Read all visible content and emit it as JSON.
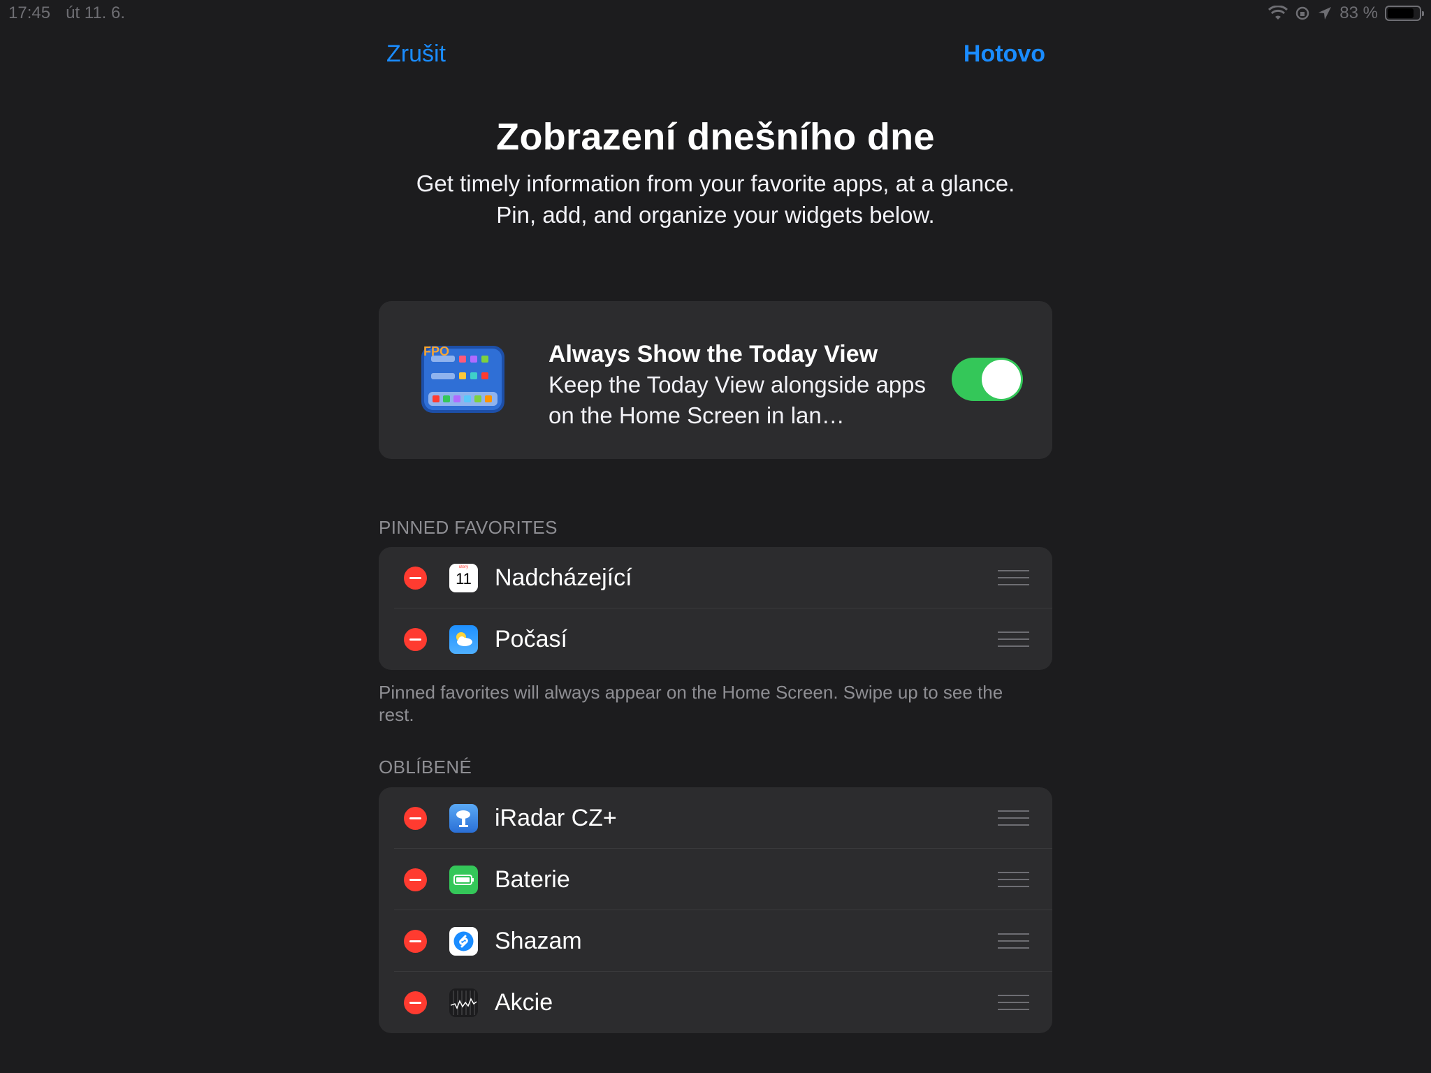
{
  "status_bar": {
    "time": "17:45",
    "date": "út 11. 6.",
    "battery_percent": "83 %",
    "battery_level": 0.83
  },
  "nav": {
    "cancel_label": "Zrušit",
    "done_label": "Hotovo"
  },
  "header": {
    "title": "Zobrazení dnešního dne",
    "subtitle_line1": "Get timely information from your favorite apps, at a glance.",
    "subtitle_line2": "Pin, add, and organize your widgets below."
  },
  "always_show": {
    "title": "Always Show the Today View",
    "description": "Keep the Today View alongside apps on the Home Screen in lan…",
    "enabled": true,
    "preview_badge": "FPO"
  },
  "pinned": {
    "header": "PINNED FAVORITES",
    "items": [
      {
        "label": "Nadcházející",
        "icon": "calendar-icon",
        "calendar_day": "11",
        "calendar_weekday": "úterý"
      },
      {
        "label": "Počasí",
        "icon": "weather-icon"
      }
    ],
    "footer": "Pinned favorites will always appear on the Home Screen. Swipe up to see the rest."
  },
  "favorites": {
    "header": "OBLÍBENÉ",
    "items": [
      {
        "label": "iRadar CZ+",
        "icon": "iradar-icon"
      },
      {
        "label": "Baterie",
        "icon": "battery-widget-icon"
      },
      {
        "label": "Shazam",
        "icon": "shazam-icon"
      },
      {
        "label": "Akcie",
        "icon": "stocks-icon"
      }
    ]
  },
  "colors": {
    "accent": "#1a8cff",
    "background": "#1c1c1e",
    "card": "#2c2c2e",
    "toggle_on": "#34c759",
    "remove": "#ff3b30"
  }
}
